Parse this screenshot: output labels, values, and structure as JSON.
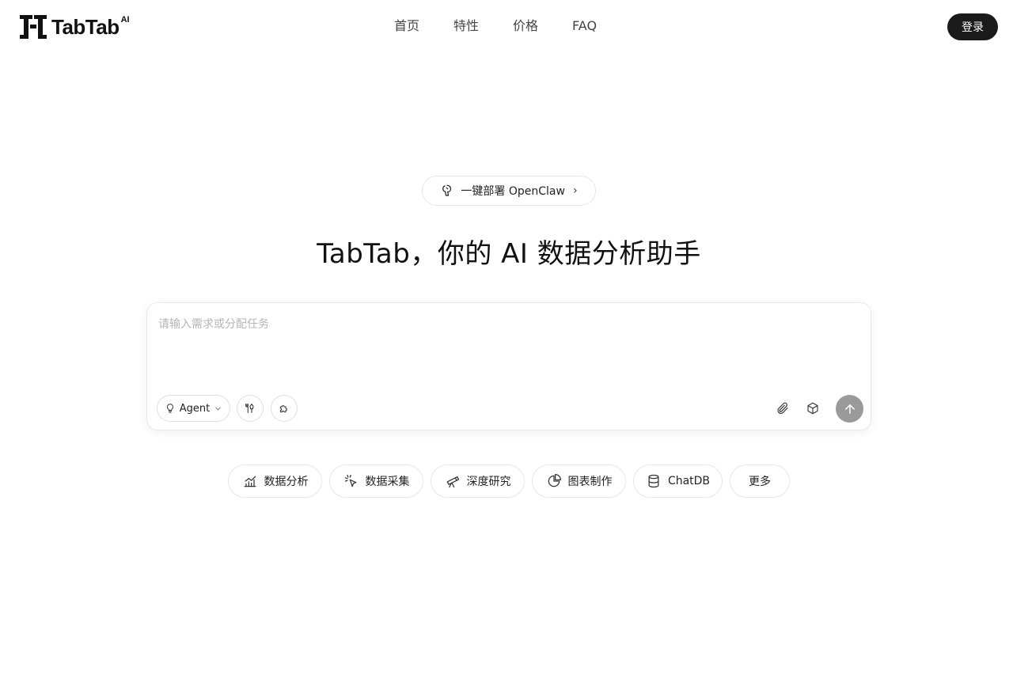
{
  "header": {
    "logo_text": "TabTab",
    "logo_sup": "AI",
    "nav": [
      {
        "label": "首页"
      },
      {
        "label": "特性"
      },
      {
        "label": "价格"
      },
      {
        "label": "FAQ"
      }
    ],
    "login_label": "登录"
  },
  "announcement": {
    "label": "一键部署 OpenClaw",
    "chevron": "›"
  },
  "headline": "TabTab，你的 AI 数据分析助手",
  "composer": {
    "placeholder": "请输入需求或分配任务",
    "value": "",
    "mode_label": "Agent"
  },
  "chips": [
    {
      "label": "数据分析",
      "icon": "chart-icon"
    },
    {
      "label": "数据采集",
      "icon": "cursor-click-icon"
    },
    {
      "label": "深度研究",
      "icon": "telescope-icon"
    },
    {
      "label": "图表制作",
      "icon": "pie-chart-icon"
    },
    {
      "label": "ChatDB",
      "icon": "database-icon"
    },
    {
      "label": "更多",
      "icon": ""
    }
  ],
  "colors": {
    "primary_dark": "#1a1a1a",
    "send_disabled": "#9a9a9a",
    "border": "#e6e6e6"
  }
}
